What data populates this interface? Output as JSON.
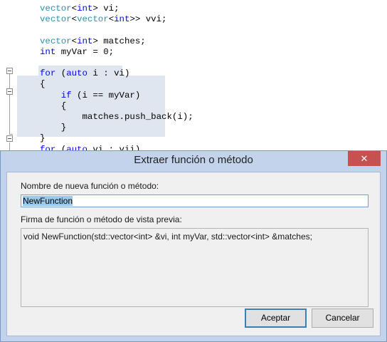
{
  "editor": {
    "lines": [
      {
        "seg": [
          [
            "ty",
            "vector"
          ],
          [
            "p",
            "<"
          ],
          [
            "kw",
            "int"
          ],
          [
            "p",
            "> vi;"
          ]
        ]
      },
      {
        "seg": [
          [
            "ty",
            "vector"
          ],
          [
            "p",
            "<"
          ],
          [
            "ty",
            "vector"
          ],
          [
            "p",
            "<"
          ],
          [
            "kw",
            "int"
          ],
          [
            "p",
            ">> vvi;"
          ]
        ]
      },
      {
        "seg": []
      },
      {
        "seg": [
          [
            "ty",
            "vector"
          ],
          [
            "p",
            "<"
          ],
          [
            "kw",
            "int"
          ],
          [
            "p",
            "> matches;"
          ]
        ]
      },
      {
        "seg": [
          [
            "kw",
            "int"
          ],
          [
            "p",
            " myVar = 0;"
          ]
        ]
      },
      {
        "seg": []
      },
      {
        "seg": [
          [
            "kw",
            "for"
          ],
          [
            "p",
            " ("
          ],
          [
            "kw",
            "auto"
          ],
          [
            "p",
            " i : vi)"
          ]
        ]
      },
      {
        "seg": [
          [
            "p",
            "{"
          ]
        ]
      },
      {
        "seg": [
          [
            "p",
            "    "
          ],
          [
            "kw",
            "if"
          ],
          [
            "p",
            " (i == myVar)"
          ]
        ]
      },
      {
        "seg": [
          [
            "p",
            "    {"
          ]
        ]
      },
      {
        "seg": [
          [
            "p",
            "        matches.push_back(i);"
          ]
        ]
      },
      {
        "seg": [
          [
            "p",
            "    }"
          ]
        ]
      },
      {
        "seg": [
          [
            "p",
            "}"
          ]
        ]
      },
      {
        "seg": [
          [
            "kw",
            "for"
          ],
          [
            "p",
            " ("
          ],
          [
            "kw",
            "auto"
          ],
          [
            "p",
            " vi : vii)"
          ]
        ]
      }
    ]
  },
  "dialog": {
    "title": "Extraer función o método",
    "close_glyph": "✕",
    "name_label": "Nombre de nueva función o método:",
    "name_value": "NewFunction",
    "preview_label": "Firma de función o método de vista previa:",
    "preview_text": "void NewFunction(std::vector<int> &vi, int myVar, std::vector<int> &matches;",
    "accept_label": "Aceptar",
    "cancel_label": "Cancelar"
  },
  "colors": {
    "keyword": "#0000ff",
    "type": "#2b91af",
    "selection": "#dfe6ef",
    "close_button": "#c75050",
    "dialog_frame": "#c3d3eb"
  },
  "icons": [
    "collapse-icon",
    "close-icon"
  ]
}
